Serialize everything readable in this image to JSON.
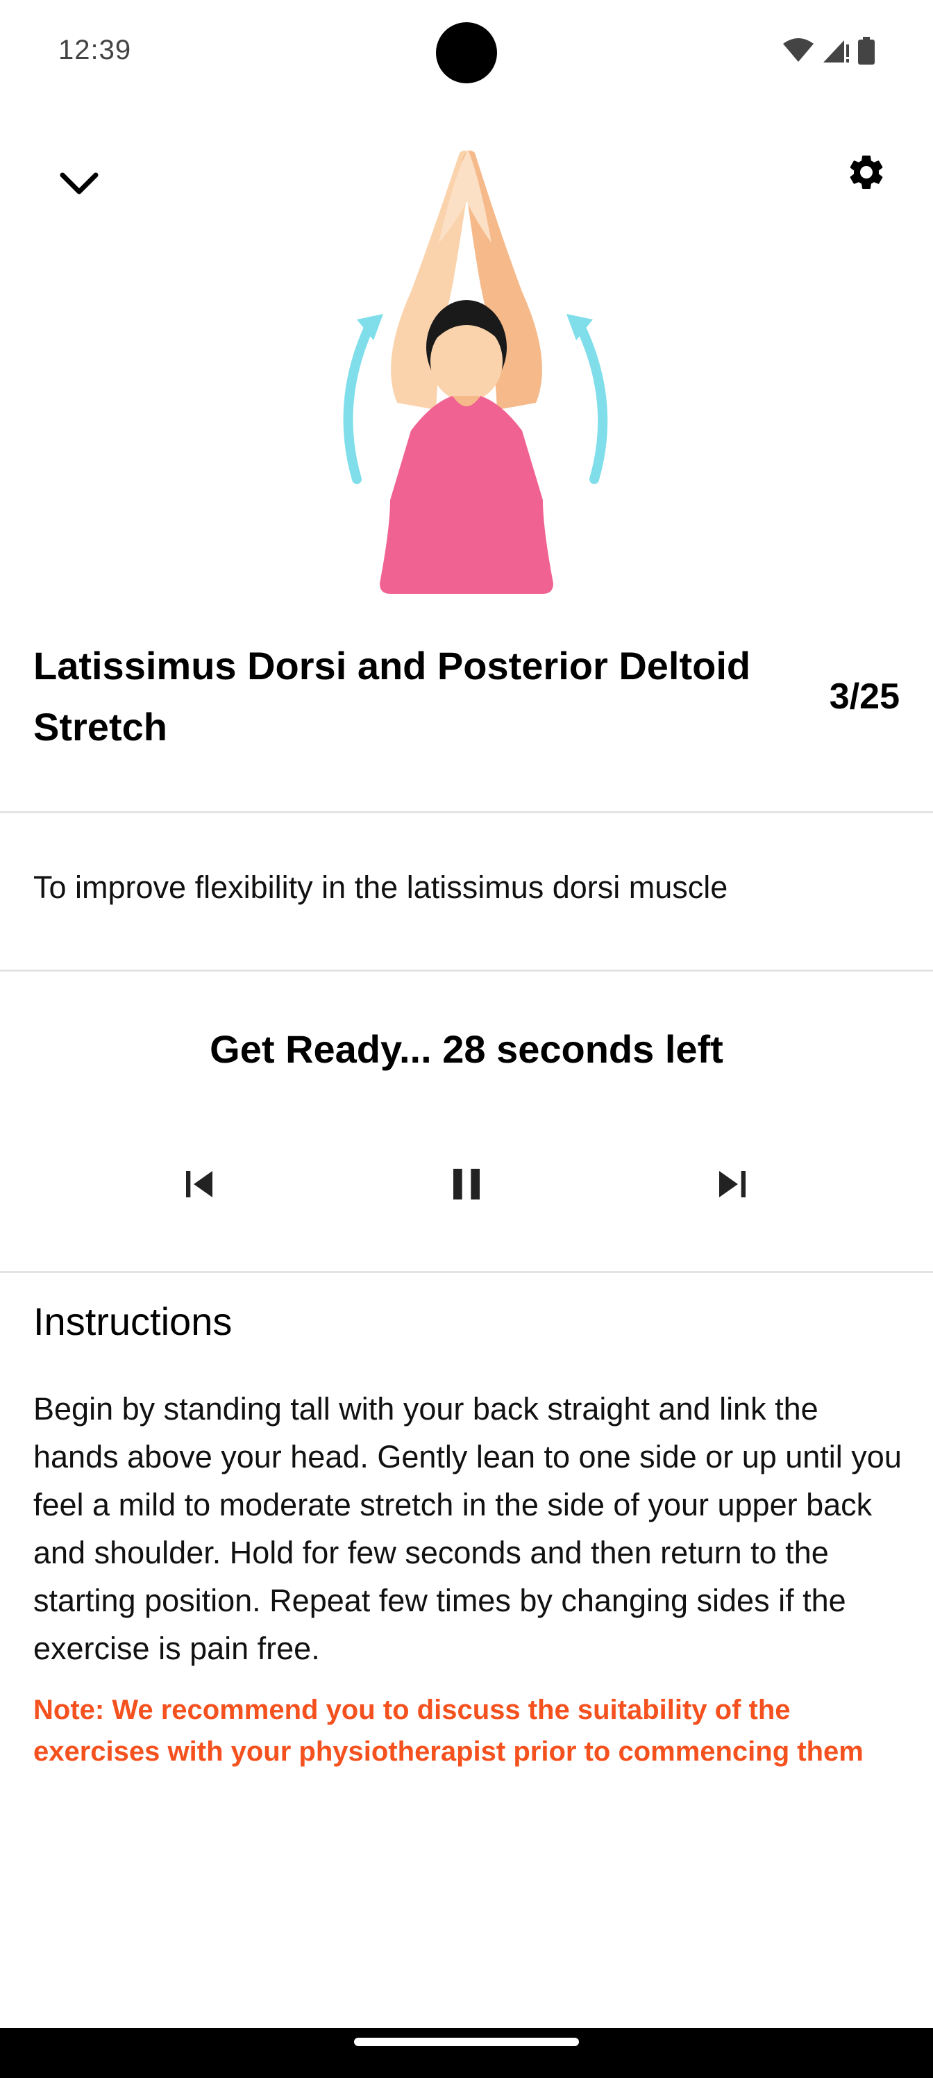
{
  "status_bar": {
    "time": "12:39",
    "icons": [
      "wifi-icon",
      "signal-icon",
      "battery-icon"
    ]
  },
  "header": {
    "collapse_icon": "chevron-down-icon",
    "settings_icon": "gear-icon"
  },
  "illustration": {
    "subject": "woman-arms-raised-stretch"
  },
  "exercise": {
    "title": "Latissimus Dorsi and Posterior Deltoid Stretch",
    "counter": "3/25",
    "purpose": "To improve flexibility in the latissimus dorsi muscle"
  },
  "timer": {
    "status_text": "Get Ready... 28 seconds left"
  },
  "controls": {
    "previous_icon": "skip-previous-icon",
    "pause_icon": "pause-icon",
    "next_icon": "skip-next-icon"
  },
  "instructions": {
    "heading": "Instructions",
    "body": "Begin by standing tall with your back straight and link the hands above your head. Gently lean to one side or up until you feel a mild to moderate stretch in the side of your upper back and shoulder. Hold for few seconds and then return to the starting position. Repeat few times by changing sides if the exercise is pain free.",
    "note": "Note: We recommend you to discuss the suitability of the exercises with your physiotherapist prior to commencing them"
  },
  "colors": {
    "note": "#f4511e",
    "divider": "#e3e3e3",
    "shirt": "#f06292",
    "skin": "#fad3ad",
    "arrow": "#80deea"
  }
}
